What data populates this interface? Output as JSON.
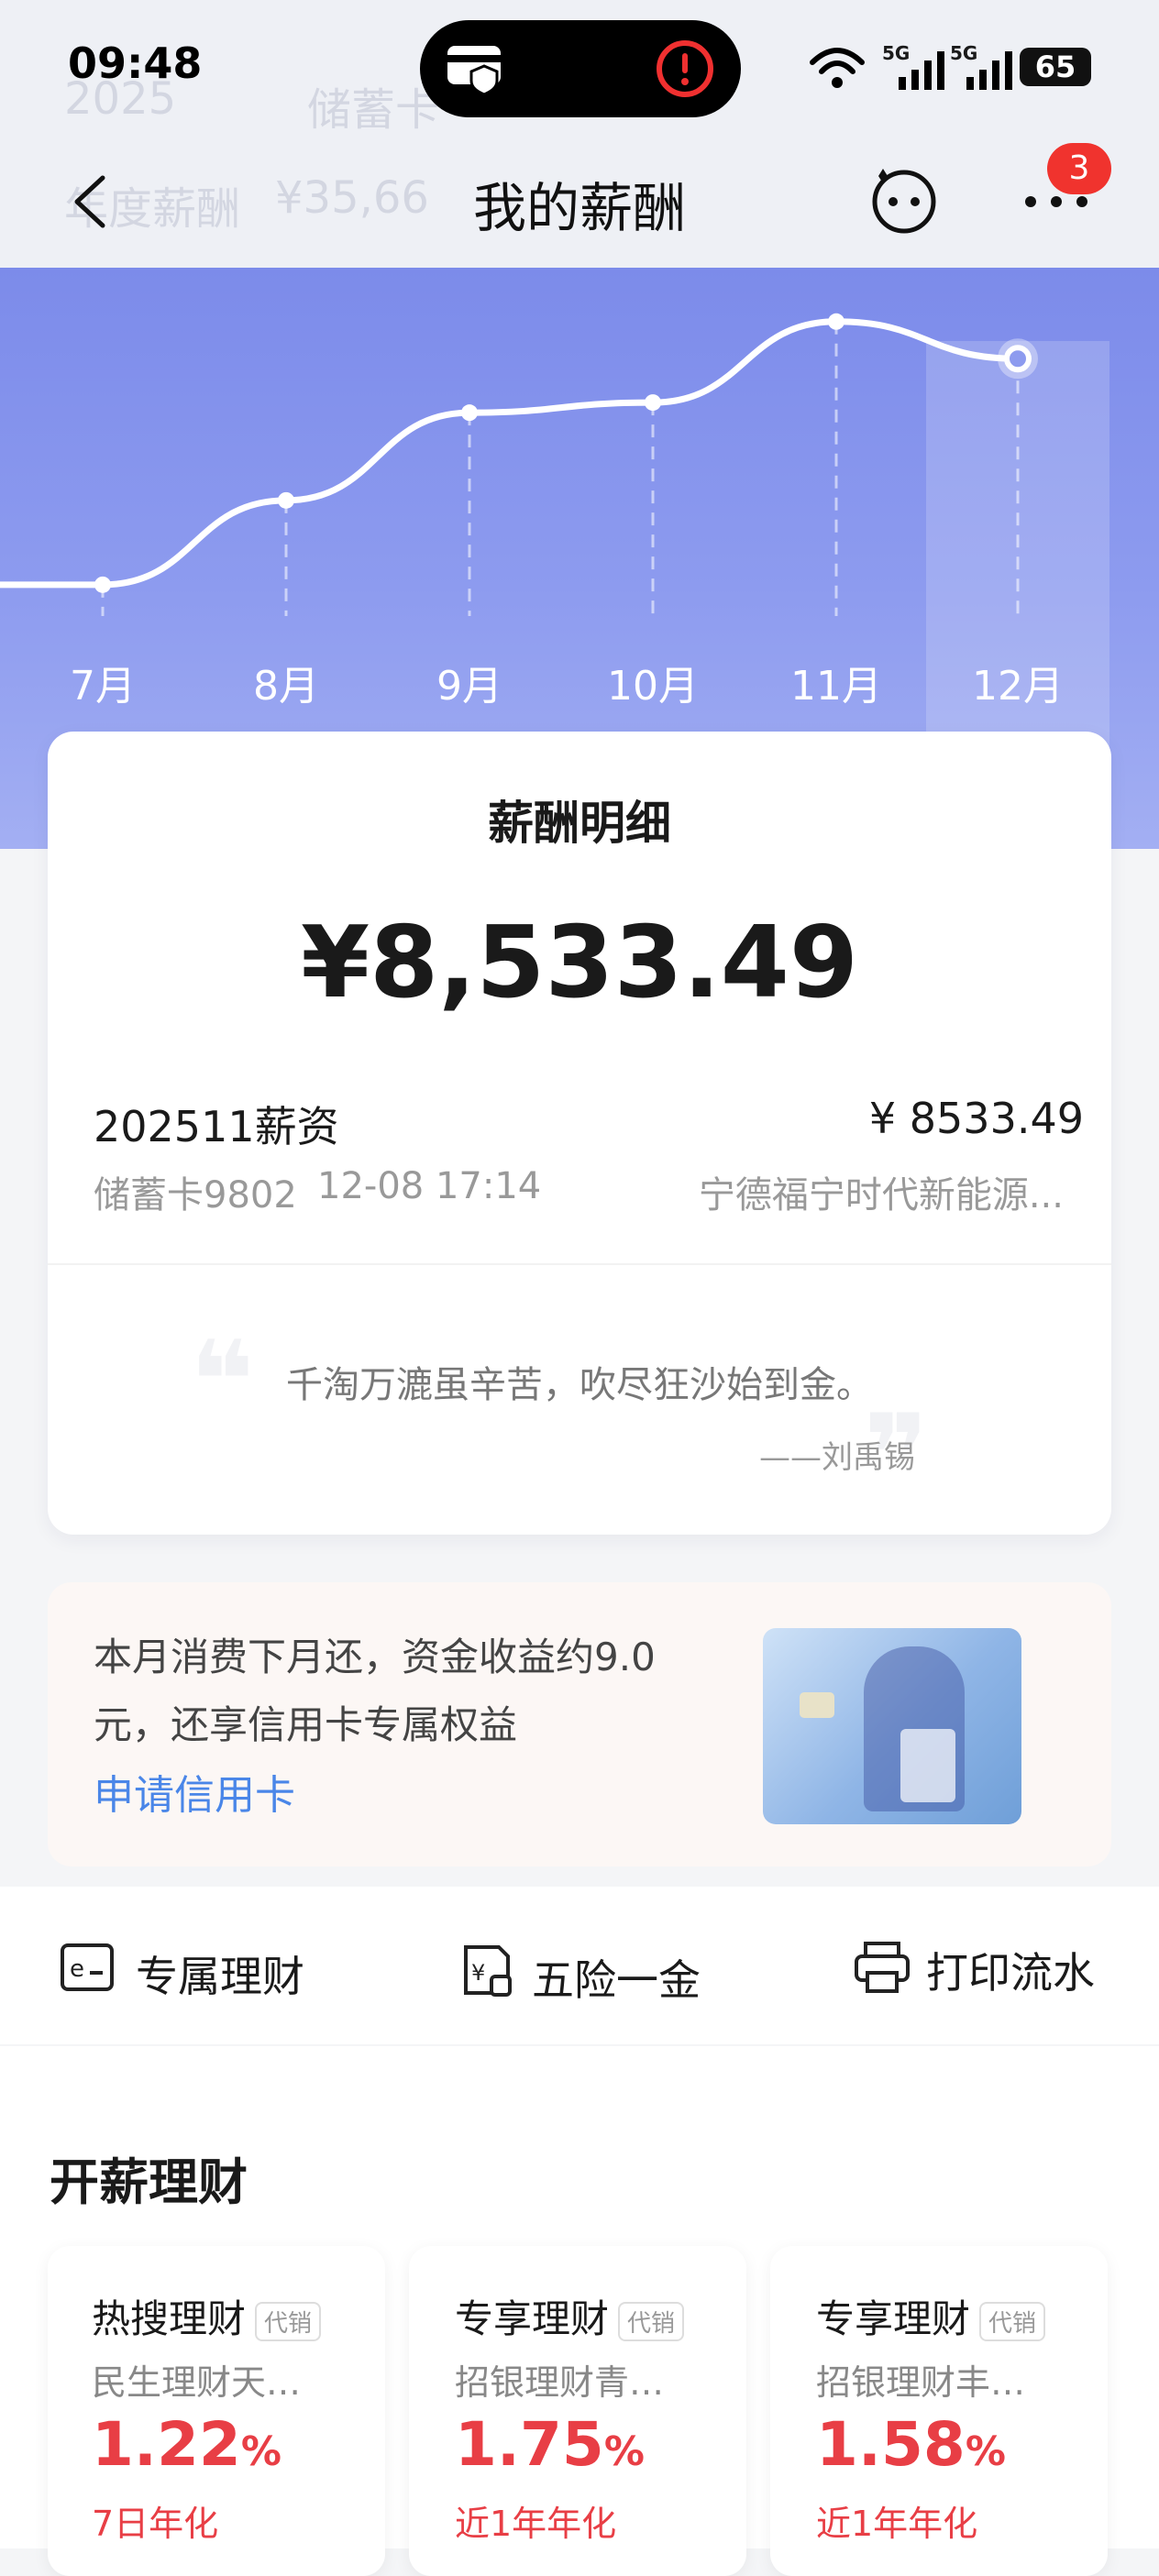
{
  "status_bar": {
    "time": "09:48",
    "battery": "65",
    "signal_1": "5G",
    "signal_2": "5G"
  },
  "header": {
    "title": "我的薪酬",
    "badge_count": "3",
    "ghost_year": "2025",
    "ghost_tab": "储蓄卡",
    "ghost_label": "年度薪酬",
    "ghost_amount": "¥35,66"
  },
  "chart_data": {
    "type": "line",
    "categories": [
      "7月",
      "8月",
      "9月",
      "10月",
      "11月",
      "12月"
    ],
    "values": [
      12,
      37,
      63,
      66,
      90,
      79
    ],
    "selected": "12月",
    "ylim": [
      0,
      100
    ]
  },
  "detail": {
    "title": "薪酬明细",
    "amount": "¥8,533.49",
    "item_name": "202511薪资",
    "item_amount": "¥ 8533.49",
    "item_account": "储蓄卡9802",
    "item_time": "12-08 17:14",
    "item_payer": "宁德福宁时代新能源...",
    "quote": "千淘万漉虽辛苦，吹尽狂沙始到金。",
    "quote_author": "——刘禹锡"
  },
  "promo": {
    "line1": "本月消费下月还，资金收益约9.0",
    "line2": "元，还享信用卡专属权益",
    "link": "申请信用卡"
  },
  "quick_actions": [
    {
      "label": "专属理财",
      "icon": "e-wallet-icon"
    },
    {
      "label": "五险一金",
      "icon": "insurance-doc-icon"
    },
    {
      "label": "打印流水",
      "icon": "printer-icon"
    }
  ],
  "finance": {
    "title": "开薪理财",
    "cards": [
      {
        "title": "热搜理财",
        "tag": "代销",
        "name": "民生理财天…",
        "rate": "1.22",
        "unit": "%",
        "period": "7日年化"
      },
      {
        "title": "专享理财",
        "tag": "代销",
        "name": "招银理财青…",
        "rate": "1.75",
        "unit": "%",
        "period": "近1年年化"
      },
      {
        "title": "专享理财",
        "tag": "代销",
        "name": "招银理财丰…",
        "rate": "1.58",
        "unit": "%",
        "period": "近1年年化"
      }
    ]
  },
  "colors": {
    "accent": "#4a86e8",
    "rate_red": "#e83e45",
    "chart_top": "#7c8bea"
  }
}
